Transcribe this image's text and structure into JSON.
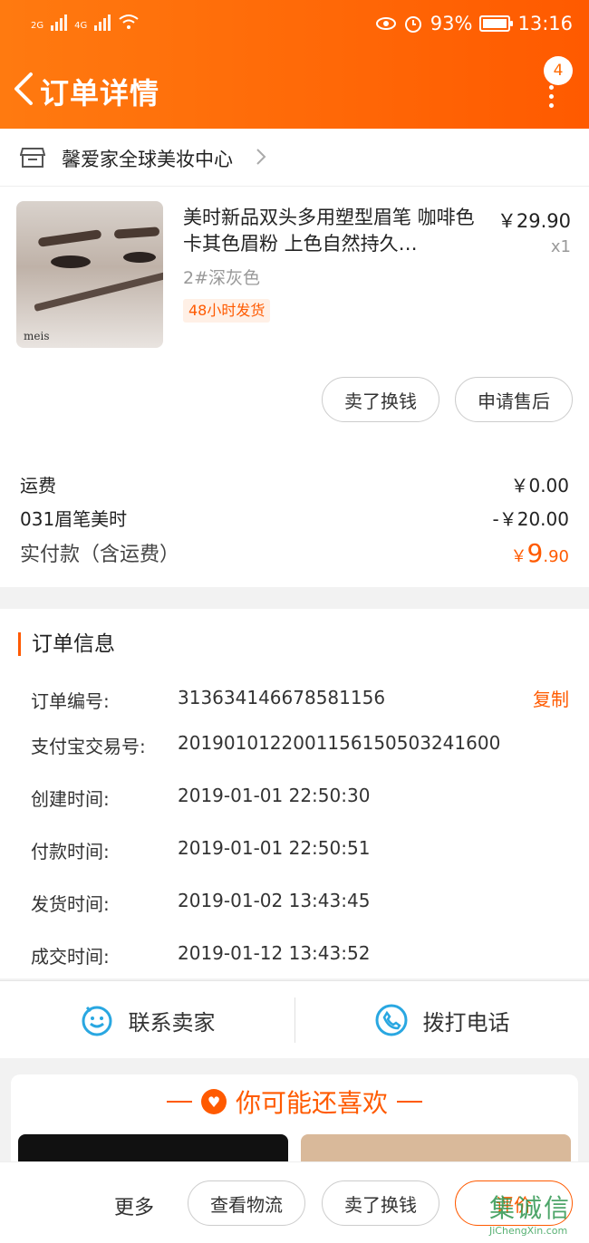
{
  "status_bar": {
    "left": [
      "2G",
      "4G"
    ],
    "battery": "93%",
    "time": "13:16"
  },
  "nav": {
    "title": "订单详情",
    "badge": "4"
  },
  "shop": {
    "name": "馨爱家全球美妆中心"
  },
  "product": {
    "title": "美时新品双头多用塑型眉笔 咖啡色卡其色眉粉 上色自然持久…",
    "price": "￥29.90",
    "qty": "x1",
    "sku": "2#深灰色",
    "tag": "48小时发货",
    "logo_text": "meis",
    "buttons": [
      "卖了换钱",
      "申请售后"
    ]
  },
  "fees": {
    "freight_label": "运费",
    "freight_value": "￥0.00",
    "coupon_label": "031眉笔美时",
    "coupon_value": "-￥20.00",
    "total_label": "实付款（含运费）",
    "total_currency": "￥",
    "total_int": "9",
    "total_dec": ".90"
  },
  "order_info": {
    "title": "订单信息",
    "copy_label": "复制",
    "rows": [
      {
        "k": "订单编号:",
        "v": "313634146678581156"
      },
      {
        "k": "支付宝交易号:",
        "v": "2019010122001156150503241600"
      },
      {
        "k": "创建时间:",
        "v": "2019-01-01 22:50:30"
      },
      {
        "k": "付款时间:",
        "v": "2019-01-01 22:50:51"
      },
      {
        "k": "发货时间:",
        "v": "2019-01-02 13:43:45"
      },
      {
        "k": "成交时间:",
        "v": "2019-01-12 13:43:52"
      }
    ]
  },
  "contact": {
    "seller": "联系卖家",
    "phone": "拨打电话"
  },
  "recommend": {
    "title": "你可能还喜欢"
  },
  "bottom": {
    "more": "更多",
    "logistics": "查看物流",
    "sell": "卖了换钱",
    "review": "评价"
  },
  "watermark": {
    "glyphs": "集诚信",
    "url": "JiChengXin.com"
  },
  "colors": {
    "accent": "#ff5a00",
    "header_from": "#ff7a10",
    "header_to": "#ff5a00",
    "contact_icon": "#29a7e1"
  }
}
